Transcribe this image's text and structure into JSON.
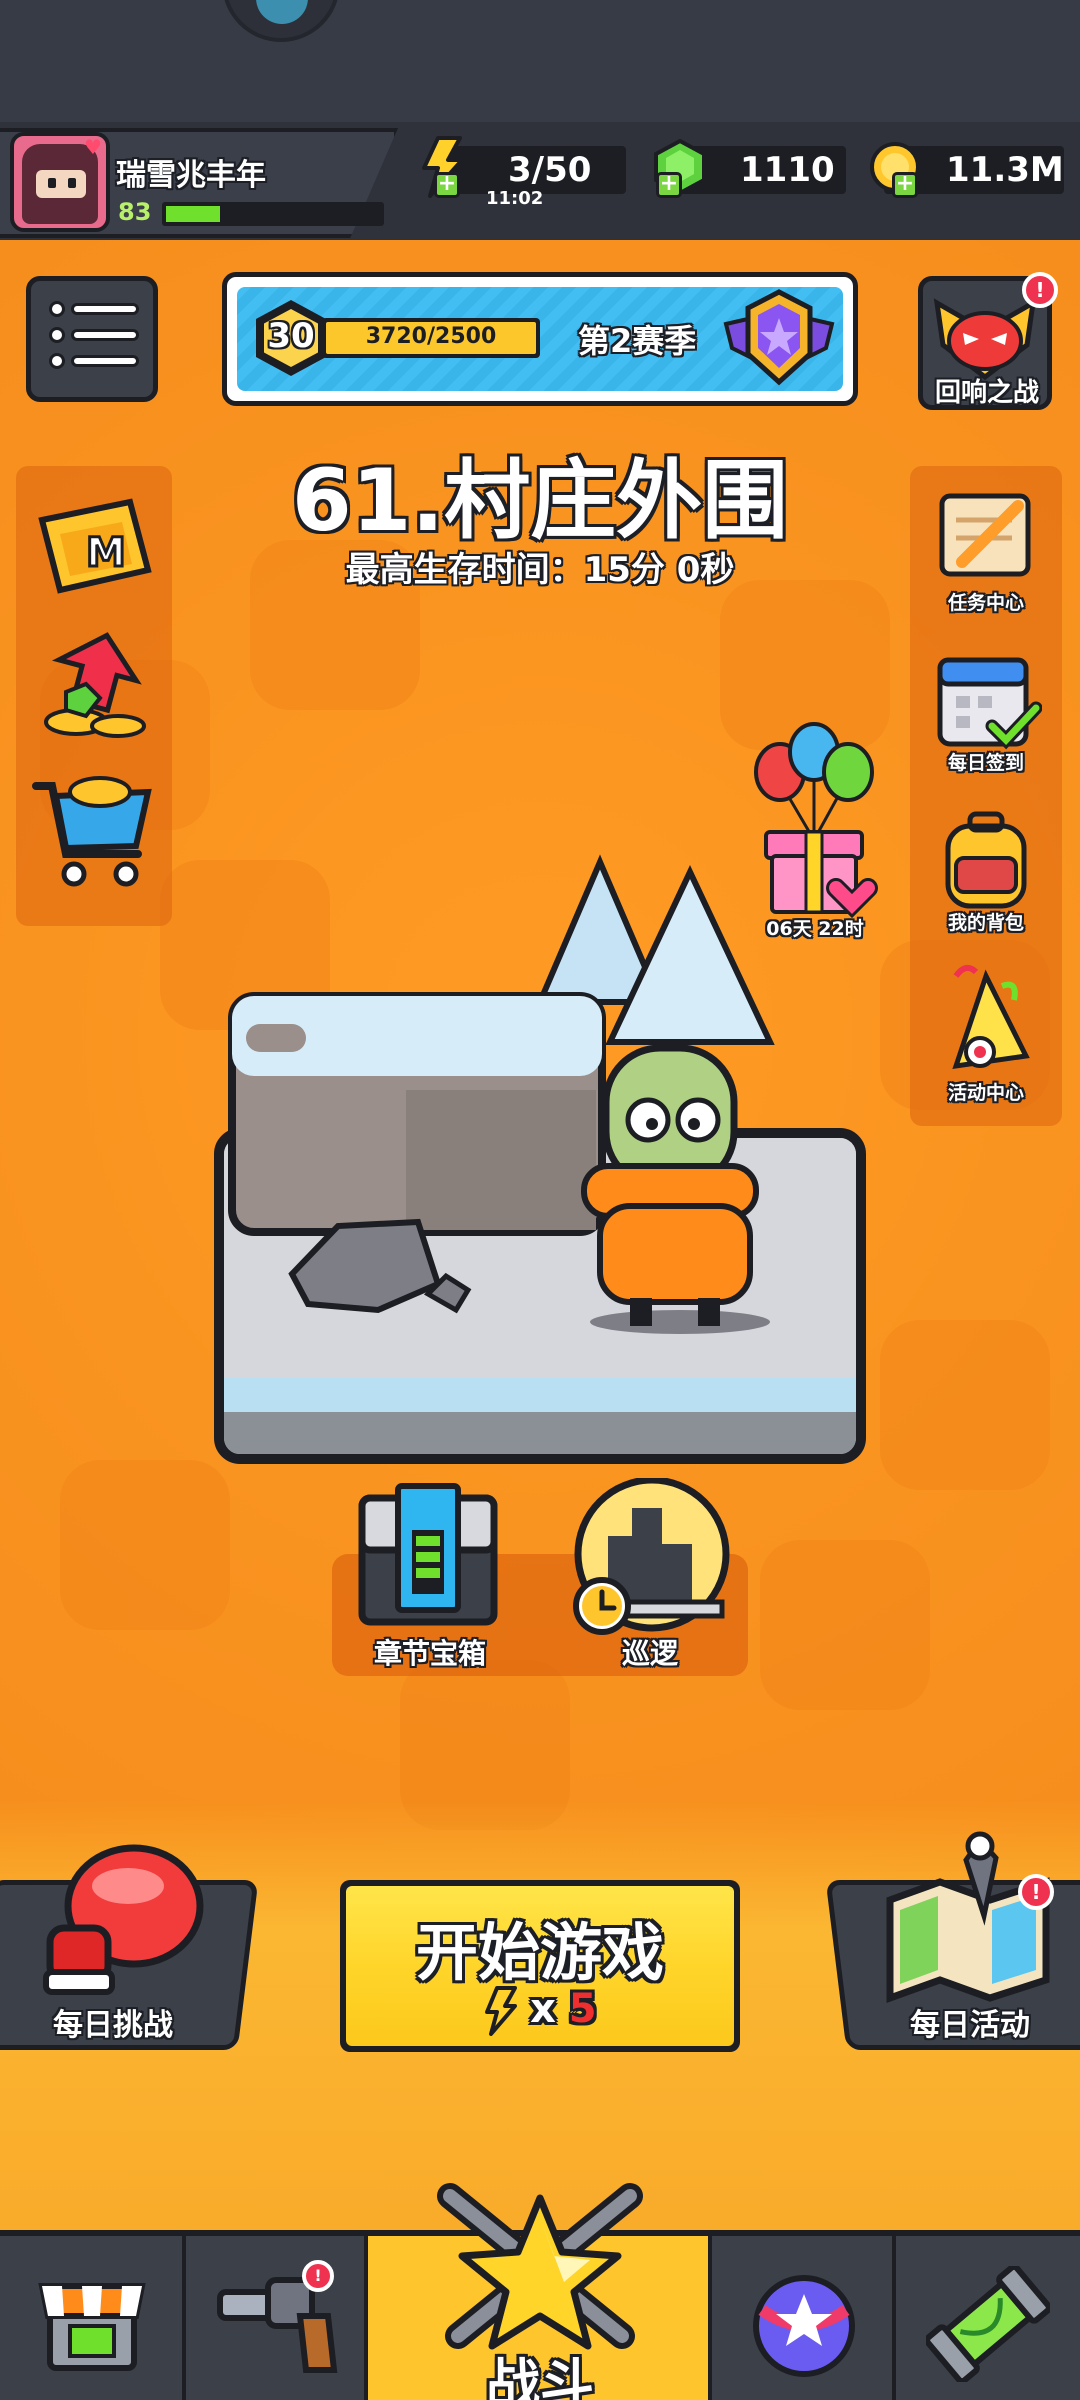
{
  "player": {
    "name": "瑞雪兆丰年",
    "level": "83",
    "xp_fraction": 0.25
  },
  "resources": {
    "energy": "3/50",
    "energy_timer": "11:02",
    "gems": "1110",
    "coins": "11.3M"
  },
  "season": {
    "level": "30",
    "progress_text": "3720/2500",
    "progress_fraction": 1.0,
    "name": "第2赛季"
  },
  "echo_battle": {
    "label": "回响之战",
    "badge": "!"
  },
  "stage": {
    "title": "61.村庄外围",
    "best_time": "最高生存时间：15分 0秒"
  },
  "left_shortcuts": [
    {
      "icon": "m-card-icon"
    },
    {
      "icon": "gem-upgrade-icon"
    },
    {
      "icon": "shopping-cart-icon"
    }
  ],
  "right_shortcuts": [
    {
      "label": "任务中心",
      "icon": "scroll-quest-icon"
    },
    {
      "label": "每日签到",
      "icon": "calendar-check-icon"
    },
    {
      "label": "我的背包",
      "icon": "backpack-icon"
    },
    {
      "label": "活动中心",
      "icon": "party-popper-icon"
    }
  ],
  "gift": {
    "timer": "06天 22时"
  },
  "sub_actions": {
    "chest_label": "章节宝箱",
    "patrol_label": "巡逻"
  },
  "daily_challenge": {
    "label": "每日挑战"
  },
  "daily_activity": {
    "label": "每日活动",
    "badge": "!"
  },
  "start": {
    "label": "开始游戏",
    "cost_mult": "x",
    "cost_num": "5"
  },
  "nav": {
    "battle_label": "战斗",
    "badge": "!"
  },
  "colors": {
    "background": "#f7901e",
    "header": "#2f323b",
    "start_button": "#ffd52a",
    "xp_fill": "#6fe12d",
    "badge_red": "#ef3250"
  }
}
